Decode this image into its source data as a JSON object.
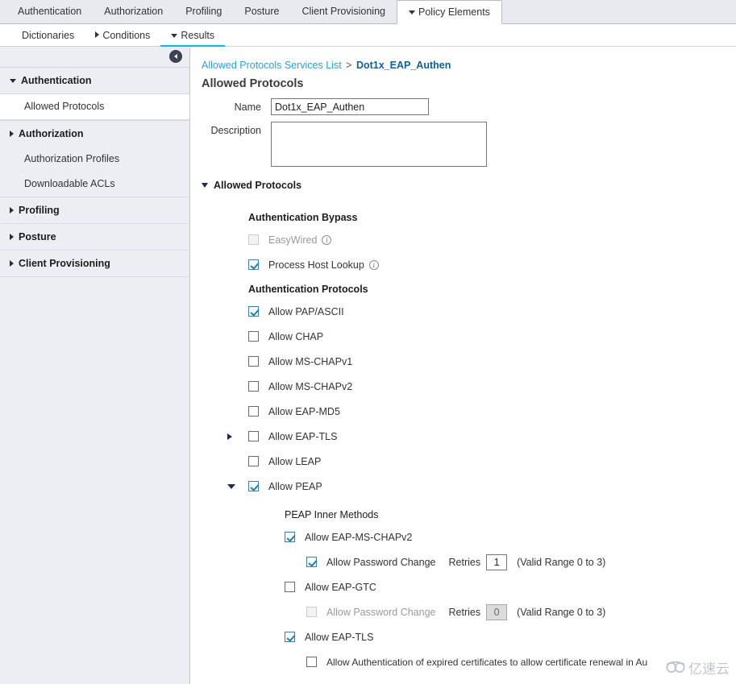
{
  "top_tabs": [
    {
      "label": "Authentication",
      "active": false,
      "caret": null
    },
    {
      "label": "Authorization",
      "active": false,
      "caret": null
    },
    {
      "label": "Profiling",
      "active": false,
      "caret": null
    },
    {
      "label": "Posture",
      "active": false,
      "caret": null
    },
    {
      "label": "Client Provisioning",
      "active": false,
      "caret": null
    },
    {
      "label": "Policy Elements",
      "active": true,
      "caret": "down"
    }
  ],
  "sub_tabs": [
    {
      "label": "Dictionaries",
      "active": false,
      "caret": null
    },
    {
      "label": "Conditions",
      "active": false,
      "caret": "right"
    },
    {
      "label": "Results",
      "active": true,
      "caret": "down"
    }
  ],
  "sidebar": {
    "collapse_icon": "chevron-left-icon",
    "groups": [
      {
        "label": "Authentication",
        "expanded": true,
        "children": [
          {
            "label": "Allowed Protocols",
            "selected": true
          }
        ]
      },
      {
        "label": "Authorization",
        "expanded": false,
        "children": [
          {
            "label": "Authorization Profiles",
            "selected": false
          },
          {
            "label": "Downloadable ACLs",
            "selected": false
          }
        ]
      },
      {
        "label": "Profiling",
        "expanded": false,
        "children": []
      },
      {
        "label": "Posture",
        "expanded": false,
        "children": []
      },
      {
        "label": "Client Provisioning",
        "expanded": false,
        "children": []
      }
    ]
  },
  "breadcrumb": {
    "link": "Allowed Protocols Services List",
    "separator": ">",
    "current": "Dot1x_EAP_Authen"
  },
  "page_title": "Allowed Protocols",
  "form": {
    "name_label": "Name",
    "name_value": "Dot1x_EAP_Authen",
    "description_label": "Description",
    "description_value": ""
  },
  "allowed_protocols_section": {
    "header": "Allowed Protocols",
    "expanded": true,
    "auth_bypass": {
      "heading": "Authentication Bypass",
      "items": [
        {
          "label": "EasyWired",
          "checked": false,
          "disabled": true,
          "info": true
        },
        {
          "label": "Process Host Lookup",
          "checked": true,
          "disabled": false,
          "info": true
        }
      ]
    },
    "auth_protocols": {
      "heading": "Authentication Protocols",
      "items": [
        {
          "label": "Allow PAP/ASCII",
          "checked": true,
          "arrow": null
        },
        {
          "label": "Allow CHAP",
          "checked": false,
          "arrow": null
        },
        {
          "label": "Allow MS-CHAPv1",
          "checked": false,
          "arrow": null
        },
        {
          "label": "Allow MS-CHAPv2",
          "checked": false,
          "arrow": null
        },
        {
          "label": "Allow EAP-MD5",
          "checked": false,
          "arrow": null
        },
        {
          "label": "Allow EAP-TLS",
          "checked": false,
          "arrow": "right"
        },
        {
          "label": "Allow LEAP",
          "checked": false,
          "arrow": null
        },
        {
          "label": "Allow PEAP",
          "checked": true,
          "arrow": "down"
        }
      ]
    },
    "peap_inner": {
      "heading": "PEAP Inner Methods",
      "mschapv2": {
        "label": "Allow EAP-MS-CHAPv2",
        "checked": true,
        "pwd_change_label": "Allow Password Change",
        "pwd_change_checked": true,
        "pwd_change_disabled": false,
        "retries_label": "Retries",
        "retries_value": "1",
        "retries_disabled": false,
        "range_hint": "(Valid Range 0 to 3)"
      },
      "gtc": {
        "label": "Allow EAP-GTC",
        "checked": false,
        "pwd_change_label": "Allow Password Change",
        "pwd_change_checked": false,
        "pwd_change_disabled": true,
        "retries_label": "Retries",
        "retries_value": "0",
        "retries_disabled": true,
        "range_hint": "(Valid Range 0 to 3)"
      },
      "eaptls": {
        "label": "Allow EAP-TLS",
        "checked": true,
        "expired_cert_label": "Allow Authentication of expired certificates to allow certificate renewal in Au",
        "expired_cert_checked": false
      }
    }
  },
  "watermark": {
    "text": "亿速云",
    "logo": "cloud-logo-icon"
  },
  "colors": {
    "accent_blue": "#00bceb",
    "link_blue": "#2e9fd0",
    "current_crumb": "#0b5f9e",
    "sidebar_bg": "#eceef3",
    "topbar_bg": "#e8eaf0",
    "check_blue": "#1e7fc0"
  }
}
